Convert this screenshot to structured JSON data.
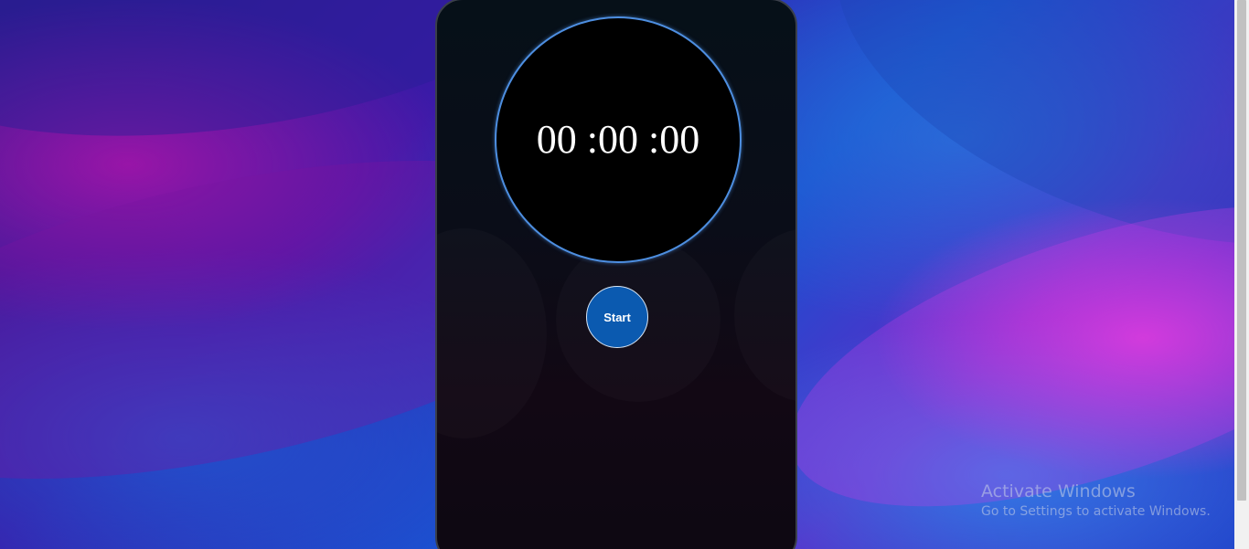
{
  "stopwatch": {
    "time_display": "00 :00 :00",
    "start_label": "Start"
  },
  "watermark": {
    "title": "Activate Windows",
    "subtitle": "Go to Settings to activate Windows."
  },
  "colors": {
    "clock_ring": "#4d8ee0",
    "start_button": "#0b5ab0",
    "clock_face": "#000000"
  }
}
